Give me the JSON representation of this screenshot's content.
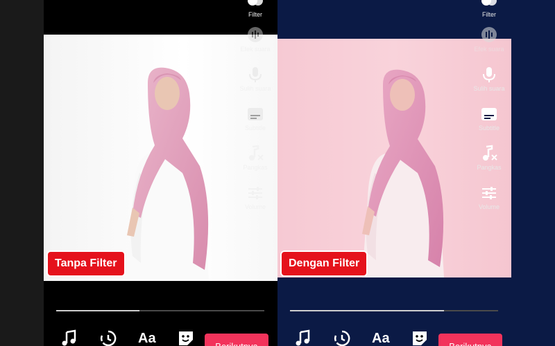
{
  "left_panel": {
    "label": "Tanpa Filter",
    "tools": [
      {
        "label": "Filter",
        "icon": "filter-icon"
      },
      {
        "label": "Efek suara",
        "icon": "sound-effect-icon"
      },
      {
        "label": "Sulih suara",
        "icon": "microphone-icon"
      },
      {
        "label": "Subtitle",
        "icon": "subtitle-icon"
      },
      {
        "label": "Pangkas",
        "icon": "trim-icon"
      },
      {
        "label": "Volume",
        "icon": "volume-icon"
      }
    ],
    "progress": 0.4,
    "bottom_tools": [
      {
        "icon": "music-icon"
      },
      {
        "icon": "timer-icon"
      },
      {
        "label": "Aa",
        "icon": "text-icon"
      },
      {
        "icon": "sticker-icon"
      }
    ],
    "next_button": "Berikutnya"
  },
  "right_panel": {
    "label": "Dengan Filter",
    "tools": [
      {
        "label": "Filter",
        "icon": "filter-icon"
      },
      {
        "label": "Efek suara",
        "icon": "sound-effect-icon"
      },
      {
        "label": "Sulih suara",
        "icon": "microphone-icon"
      },
      {
        "label": "Subtitle",
        "icon": "subtitle-icon"
      },
      {
        "label": "Pangkas",
        "icon": "trim-icon"
      },
      {
        "label": "Volume",
        "icon": "volume-icon"
      }
    ],
    "progress": 0.74,
    "bottom_tools": [
      {
        "icon": "music-icon"
      },
      {
        "icon": "timer-icon"
      },
      {
        "label": "Aa",
        "icon": "text-icon"
      },
      {
        "icon": "sticker-icon"
      }
    ],
    "next_button": "Berikutnya"
  },
  "colors": {
    "badge": "#e5121c",
    "next_button": "#f2335b",
    "right_background": "#0b1a45",
    "hijab_pink": "#e6a3bf"
  }
}
